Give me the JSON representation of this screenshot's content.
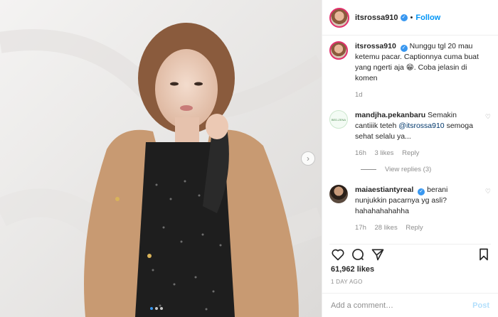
{
  "post": {
    "username": "itsrossa910",
    "follow_label": "Follow",
    "separator": "•",
    "caption_username": "itsrossa910",
    "caption_text": "Nunggu tgl 20 mau ketemu pacar. Captionnya cuma buat yang ngerti aja 😁. Coba jelasin di komen",
    "caption_time": "1d",
    "likes": "61,962 likes",
    "date": "1 DAY AGO",
    "add_comment_placeholder": "Add a comment…",
    "post_label": "Post",
    "carousel_next_icon": "›"
  },
  "comments": [
    {
      "username": "mandjha.pekanbaru",
      "text_before": "Semakin cantiiik teteh ",
      "mention": "@itsrossa910",
      "text_after": " semoga sehat selalu ya...",
      "time": "16h",
      "likes": "3 likes",
      "reply": "Reply",
      "view_replies": "View replies (3)",
      "avatar_text": "BED-ZENA"
    },
    {
      "username": "maiaestiantyreal",
      "text": "berani nunjukkin pacarnya yg asli? hahahahahahha",
      "time": "17h",
      "likes": "28 likes",
      "reply": "Reply"
    }
  ],
  "colors": {
    "accent": "#0095f6",
    "verified": "#3897f0",
    "muted": "#8e8e8e",
    "post_disabled": "#b2dffc"
  },
  "icons": [
    "heart-icon",
    "comment-icon",
    "share-icon",
    "bookmark-icon",
    "verified-badge-icon",
    "chevron-right-icon"
  ],
  "carousel": {
    "active_index": 1,
    "count": 3
  }
}
